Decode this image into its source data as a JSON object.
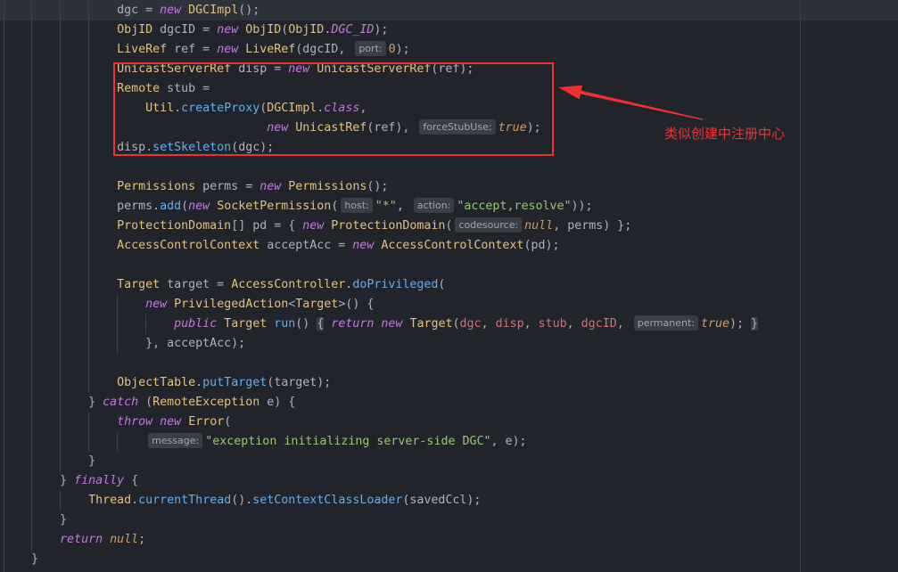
{
  "theme": {
    "background": "#21252b",
    "current_line": "#2c313a",
    "indent_guide": "#3a3f4b",
    "text": "#abb2bf",
    "hint_background": "#3a3d44",
    "hint_text": "#a2a6ad"
  },
  "syntax_colors": {
    "p": "#abb2bf",
    "kw": "#c678dd",
    "ty": "#e5c07b",
    "fn": "#61afef",
    "str": "#98c379",
    "num": "#d19a66",
    "lit": "#d19a66",
    "cst": "#c678dd",
    "cap": "#e06c75",
    "fold": "#abb2bf"
  },
  "editor": {
    "lines": [
      {
        "tokens": [
          {
            "text": "                dgc = ",
            "kind": "p"
          },
          {
            "text": "new",
            "kind": "kw"
          },
          {
            "text": " ",
            "kind": "p"
          },
          {
            "text": "DGCImpl",
            "kind": "ty"
          },
          {
            "text": "();",
            "kind": "p"
          }
        ]
      },
      {
        "tokens": [
          {
            "text": "                ",
            "kind": "p"
          },
          {
            "text": "ObjID",
            "kind": "ty"
          },
          {
            "text": " dgcID = ",
            "kind": "p"
          },
          {
            "text": "new",
            "kind": "kw"
          },
          {
            "text": " ",
            "kind": "p"
          },
          {
            "text": "ObjID",
            "kind": "ty"
          },
          {
            "text": "(",
            "kind": "p"
          },
          {
            "text": "ObjID",
            "kind": "ty"
          },
          {
            "text": ".",
            "kind": "p"
          },
          {
            "text": "DGC_ID",
            "kind": "cst"
          },
          {
            "text": ");",
            "kind": "p"
          }
        ]
      },
      {
        "tokens": [
          {
            "text": "                ",
            "kind": "p"
          },
          {
            "text": "LiveRef",
            "kind": "ty"
          },
          {
            "text": " ref = ",
            "kind": "p"
          },
          {
            "text": "new",
            "kind": "kw"
          },
          {
            "text": " ",
            "kind": "p"
          },
          {
            "text": "LiveRef",
            "kind": "ty"
          },
          {
            "text": "(dgcID, ",
            "kind": "p"
          },
          {
            "text": "port:",
            "kind": "hint"
          },
          {
            "text": "0",
            "kind": "num"
          },
          {
            "text": ");",
            "kind": "p"
          }
        ]
      },
      {
        "tokens": [
          {
            "text": "                ",
            "kind": "p"
          },
          {
            "text": "UnicastServerRef",
            "kind": "ty"
          },
          {
            "text": " disp = ",
            "kind": "p"
          },
          {
            "text": "new",
            "kind": "kw"
          },
          {
            "text": " ",
            "kind": "p"
          },
          {
            "text": "UnicastServerRef",
            "kind": "ty"
          },
          {
            "text": "(ref);",
            "kind": "p"
          }
        ]
      },
      {
        "tokens": [
          {
            "text": "                ",
            "kind": "p"
          },
          {
            "text": "Remote",
            "kind": "ty"
          },
          {
            "text": " stub =",
            "kind": "p"
          }
        ]
      },
      {
        "tokens": [
          {
            "text": "                    ",
            "kind": "p"
          },
          {
            "text": "Util",
            "kind": "ty"
          },
          {
            "text": ".",
            "kind": "p"
          },
          {
            "text": "createProxy",
            "kind": "fn"
          },
          {
            "text": "(",
            "kind": "p"
          },
          {
            "text": "DGCImpl",
            "kind": "ty"
          },
          {
            "text": ".",
            "kind": "p"
          },
          {
            "text": "class",
            "kind": "kw"
          },
          {
            "text": ",",
            "kind": "p"
          }
        ]
      },
      {
        "tokens": [
          {
            "text": "                                     ",
            "kind": "p"
          },
          {
            "text": "new",
            "kind": "kw"
          },
          {
            "text": " ",
            "kind": "p"
          },
          {
            "text": "UnicastRef",
            "kind": "ty"
          },
          {
            "text": "(ref), ",
            "kind": "p"
          },
          {
            "text": "forceStubUse:",
            "kind": "hint"
          },
          {
            "text": "true",
            "kind": "lit"
          },
          {
            "text": ");",
            "kind": "p"
          }
        ]
      },
      {
        "tokens": [
          {
            "text": "                disp.",
            "kind": "p"
          },
          {
            "text": "setSkeleton",
            "kind": "fn"
          },
          {
            "text": "(dgc);",
            "kind": "p"
          }
        ]
      },
      {
        "tokens": []
      },
      {
        "tokens": [
          {
            "text": "                ",
            "kind": "p"
          },
          {
            "text": "Permissions",
            "kind": "ty"
          },
          {
            "text": " perms = ",
            "kind": "p"
          },
          {
            "text": "new",
            "kind": "kw"
          },
          {
            "text": " ",
            "kind": "p"
          },
          {
            "text": "Permissions",
            "kind": "ty"
          },
          {
            "text": "();",
            "kind": "p"
          }
        ]
      },
      {
        "tokens": [
          {
            "text": "                perms.",
            "kind": "p"
          },
          {
            "text": "add",
            "kind": "fn"
          },
          {
            "text": "(",
            "kind": "p"
          },
          {
            "text": "new",
            "kind": "kw"
          },
          {
            "text": " ",
            "kind": "p"
          },
          {
            "text": "SocketPermission",
            "kind": "ty"
          },
          {
            "text": "(",
            "kind": "p"
          },
          {
            "text": "host:",
            "kind": "hint"
          },
          {
            "text": "\"*\"",
            "kind": "str"
          },
          {
            "text": ", ",
            "kind": "p"
          },
          {
            "text": "action:",
            "kind": "hint"
          },
          {
            "text": "\"accept,resolve\"",
            "kind": "str"
          },
          {
            "text": "));",
            "kind": "p"
          }
        ]
      },
      {
        "tokens": [
          {
            "text": "                ",
            "kind": "p"
          },
          {
            "text": "ProtectionDomain",
            "kind": "ty"
          },
          {
            "text": "[] pd = { ",
            "kind": "p"
          },
          {
            "text": "new",
            "kind": "kw"
          },
          {
            "text": " ",
            "kind": "p"
          },
          {
            "text": "ProtectionDomain",
            "kind": "ty"
          },
          {
            "text": "(",
            "kind": "p"
          },
          {
            "text": "codesource:",
            "kind": "hint"
          },
          {
            "text": "null",
            "kind": "lit"
          },
          {
            "text": ", perms) };",
            "kind": "p"
          }
        ]
      },
      {
        "tokens": [
          {
            "text": "                ",
            "kind": "p"
          },
          {
            "text": "AccessControlContext",
            "kind": "ty"
          },
          {
            "text": " acceptAcc = ",
            "kind": "p"
          },
          {
            "text": "new",
            "kind": "kw"
          },
          {
            "text": " ",
            "kind": "p"
          },
          {
            "text": "AccessControlContext",
            "kind": "ty"
          },
          {
            "text": "(pd);",
            "kind": "p"
          }
        ]
      },
      {
        "tokens": []
      },
      {
        "tokens": [
          {
            "text": "                ",
            "kind": "p"
          },
          {
            "text": "Target",
            "kind": "ty"
          },
          {
            "text": " target = ",
            "kind": "p"
          },
          {
            "text": "AccessController",
            "kind": "ty"
          },
          {
            "text": ".",
            "kind": "p"
          },
          {
            "text": "doPrivileged",
            "kind": "fn"
          },
          {
            "text": "(",
            "kind": "p"
          }
        ]
      },
      {
        "tokens": [
          {
            "text": "                    ",
            "kind": "p"
          },
          {
            "text": "new",
            "kind": "kw"
          },
          {
            "text": " ",
            "kind": "p"
          },
          {
            "text": "PrivilegedAction",
            "kind": "ty"
          },
          {
            "text": "<",
            "kind": "p"
          },
          {
            "text": "Target",
            "kind": "ty"
          },
          {
            "text": ">() {",
            "kind": "p"
          }
        ]
      },
      {
        "tokens": [
          {
            "text": "                        ",
            "kind": "p"
          },
          {
            "text": "public",
            "kind": "kw"
          },
          {
            "text": " ",
            "kind": "p"
          },
          {
            "text": "Target",
            "kind": "ty"
          },
          {
            "text": " ",
            "kind": "p"
          },
          {
            "text": "run",
            "kind": "fn"
          },
          {
            "text": "() ",
            "kind": "p"
          },
          {
            "text": "{",
            "kind": "fold"
          },
          {
            "text": " ",
            "kind": "p"
          },
          {
            "text": "return",
            "kind": "kw"
          },
          {
            "text": " ",
            "kind": "p"
          },
          {
            "text": "new",
            "kind": "kw"
          },
          {
            "text": " ",
            "kind": "p"
          },
          {
            "text": "Target",
            "kind": "ty"
          },
          {
            "text": "(",
            "kind": "p"
          },
          {
            "text": "dgc",
            "kind": "cap"
          },
          {
            "text": ", ",
            "kind": "p"
          },
          {
            "text": "disp",
            "kind": "cap"
          },
          {
            "text": ", ",
            "kind": "p"
          },
          {
            "text": "stub",
            "kind": "cap"
          },
          {
            "text": ", ",
            "kind": "p"
          },
          {
            "text": "dgcID",
            "kind": "cap"
          },
          {
            "text": ", ",
            "kind": "p"
          },
          {
            "text": "permanent:",
            "kind": "hint"
          },
          {
            "text": "true",
            "kind": "lit"
          },
          {
            "text": "); ",
            "kind": "p"
          },
          {
            "text": "}",
            "kind": "fold"
          }
        ]
      },
      {
        "tokens": [
          {
            "text": "                    }, acceptAcc);",
            "kind": "p"
          }
        ]
      },
      {
        "tokens": []
      },
      {
        "tokens": [
          {
            "text": "                ",
            "kind": "p"
          },
          {
            "text": "ObjectTable",
            "kind": "ty"
          },
          {
            "text": ".",
            "kind": "p"
          },
          {
            "text": "putTarget",
            "kind": "fn"
          },
          {
            "text": "(target);",
            "kind": "p"
          }
        ]
      },
      {
        "tokens": [
          {
            "text": "            } ",
            "kind": "p"
          },
          {
            "text": "catch",
            "kind": "kw"
          },
          {
            "text": " (",
            "kind": "p"
          },
          {
            "text": "RemoteException",
            "kind": "ty"
          },
          {
            "text": " e) {",
            "kind": "p"
          }
        ]
      },
      {
        "tokens": [
          {
            "text": "                ",
            "kind": "p"
          },
          {
            "text": "throw",
            "kind": "kw"
          },
          {
            "text": " ",
            "kind": "p"
          },
          {
            "text": "new",
            "kind": "kw"
          },
          {
            "text": " ",
            "kind": "p"
          },
          {
            "text": "Error",
            "kind": "ty"
          },
          {
            "text": "(",
            "kind": "p"
          }
        ]
      },
      {
        "tokens": [
          {
            "text": "                    ",
            "kind": "p"
          },
          {
            "text": "message:",
            "kind": "hint"
          },
          {
            "text": "\"exception initializing server-side DGC\"",
            "kind": "str"
          },
          {
            "text": ", e);",
            "kind": "p"
          }
        ]
      },
      {
        "tokens": [
          {
            "text": "            }",
            "kind": "p"
          }
        ]
      },
      {
        "tokens": [
          {
            "text": "        } ",
            "kind": "p"
          },
          {
            "text": "finally",
            "kind": "kw"
          },
          {
            "text": " {",
            "kind": "p"
          }
        ]
      },
      {
        "tokens": [
          {
            "text": "            ",
            "kind": "p"
          },
          {
            "text": "Thread",
            "kind": "ty"
          },
          {
            "text": ".",
            "kind": "p"
          },
          {
            "text": "currentThread",
            "kind": "fn"
          },
          {
            "text": "().",
            "kind": "p"
          },
          {
            "text": "setContextClassLoader",
            "kind": "fn"
          },
          {
            "text": "(savedCcl);",
            "kind": "p"
          }
        ]
      },
      {
        "tokens": [
          {
            "text": "        }",
            "kind": "p"
          }
        ]
      },
      {
        "tokens": [
          {
            "text": "        ",
            "kind": "p"
          },
          {
            "text": "return",
            "kind": "kw"
          },
          {
            "text": " ",
            "kind": "p"
          },
          {
            "text": "null",
            "kind": "lit"
          },
          {
            "text": ";",
            "kind": "p"
          }
        ]
      },
      {
        "tokens": [
          {
            "text": "    }",
            "kind": "p"
          }
        ]
      }
    ]
  },
  "annotation": {
    "label": "类似创建中注册中心",
    "color": "#f23030"
  }
}
